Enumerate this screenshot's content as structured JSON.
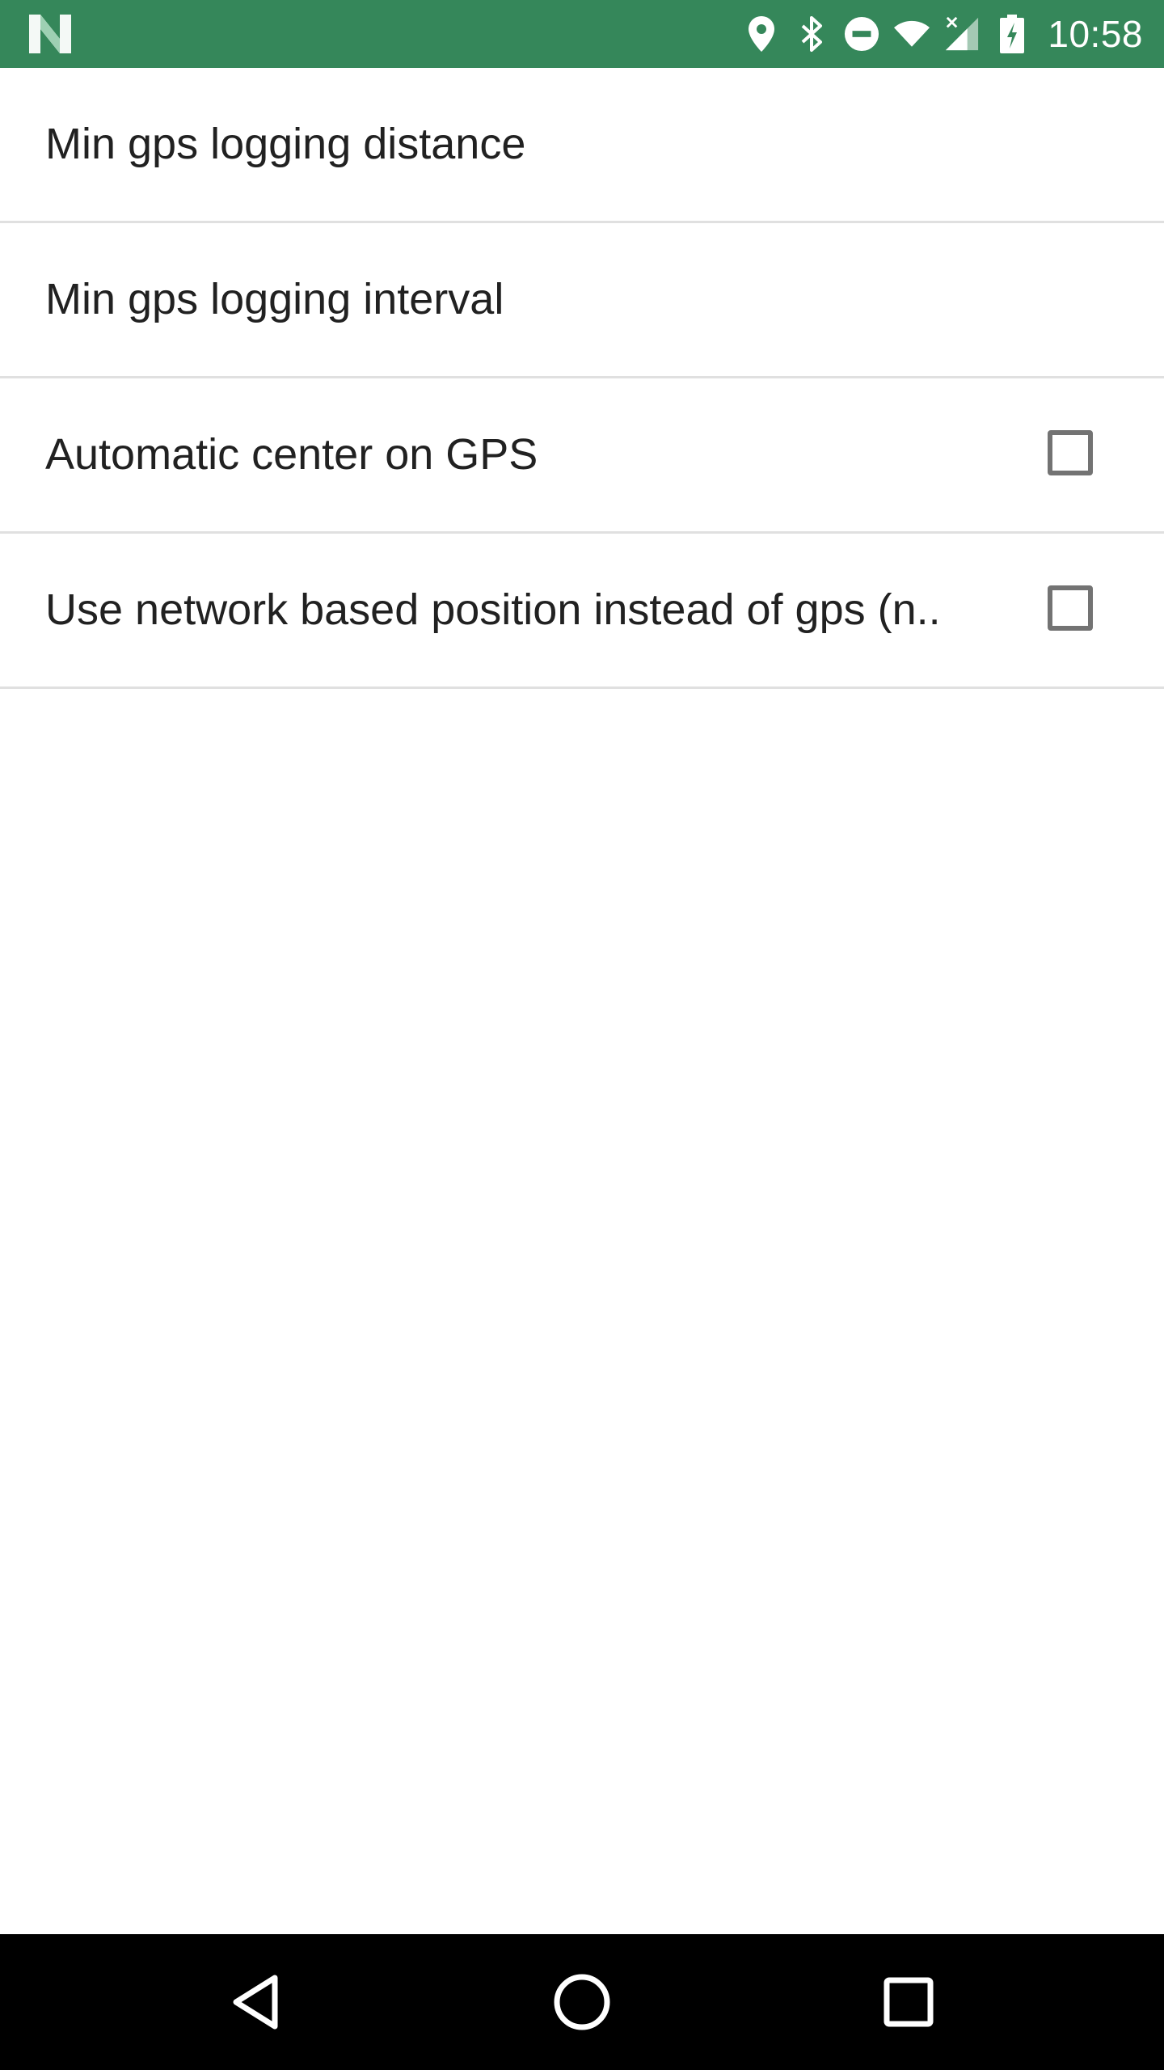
{
  "status_bar": {
    "background_color": "#35875a",
    "left_icon": "n-logo-icon",
    "icons": [
      "location-icon",
      "bluetooth-icon",
      "do-not-disturb-icon",
      "wifi-icon",
      "signal-icon",
      "battery-charging-icon"
    ],
    "time": "10:58"
  },
  "preferences": [
    {
      "title": "Min gps logging distance",
      "has_checkbox": false
    },
    {
      "title": "Min gps logging interval",
      "has_checkbox": false
    },
    {
      "title": "Automatic center on GPS",
      "has_checkbox": true,
      "checked": false
    },
    {
      "title": "Use network based position instead of gps (n..",
      "has_checkbox": true,
      "checked": false
    }
  ],
  "nav_bar": {
    "buttons": [
      "back-icon",
      "home-icon",
      "recents-icon"
    ]
  }
}
